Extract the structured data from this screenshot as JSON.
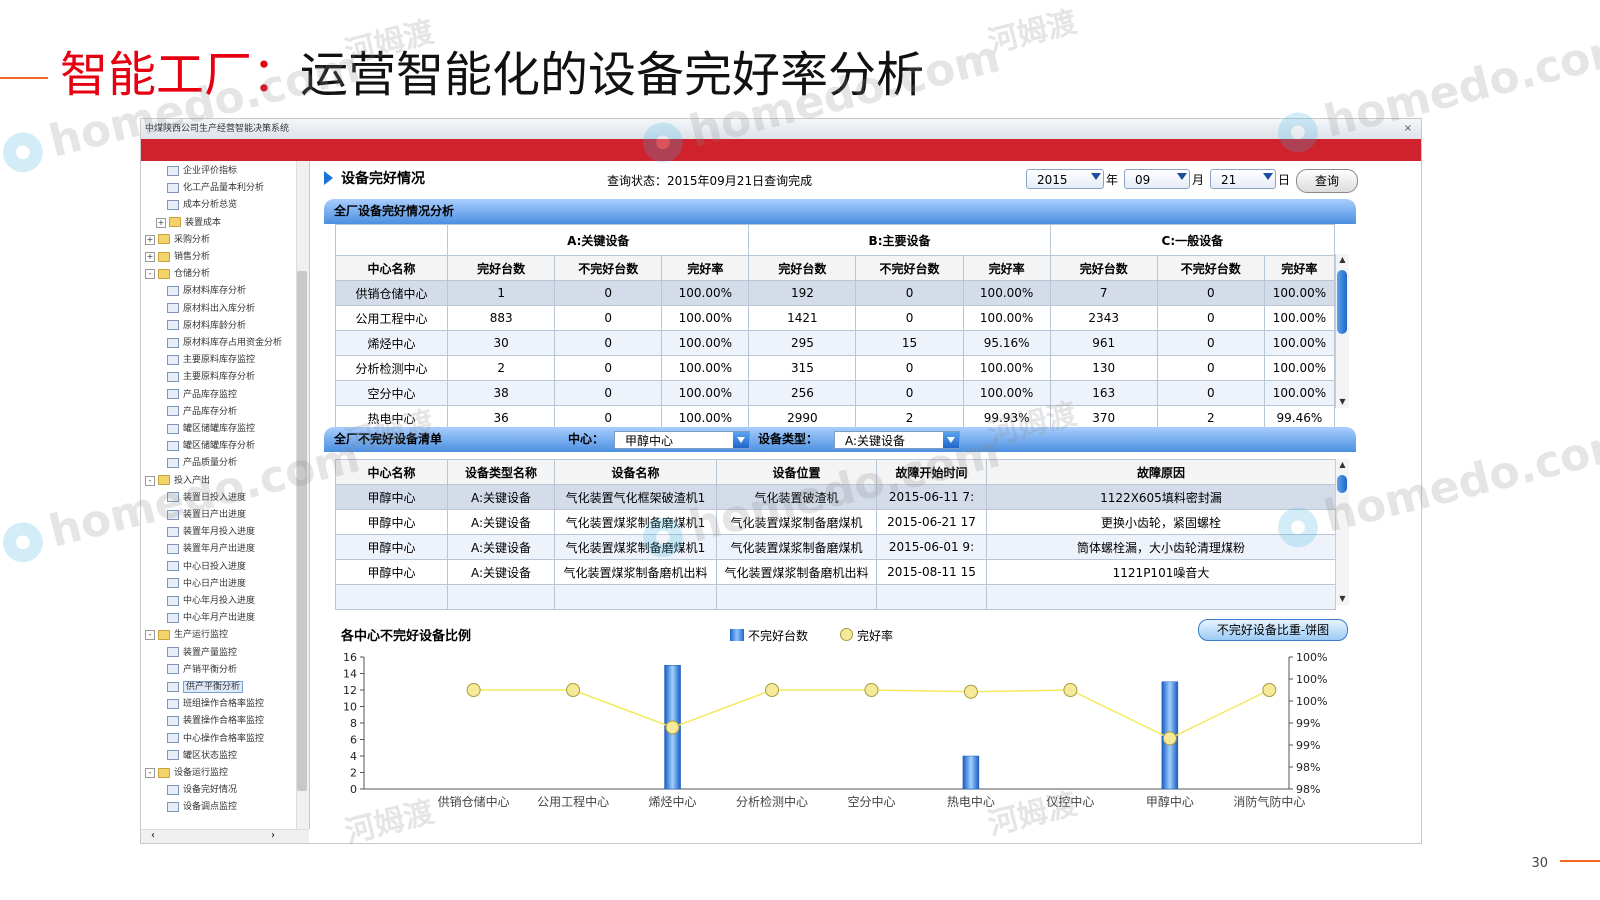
{
  "slide": {
    "title_prefix": "智能工厂：",
    "title_main": "运营智能化的设备完好率分析",
    "page_number": "30",
    "watermark_cn": "河姆渡",
    "watermark_en": "homedo.com"
  },
  "app": {
    "window_title": "中煤陕西公司生产经营智能决策系统",
    "close_label": "×"
  },
  "tree": {
    "items": [
      {
        "label": "企业评价指标",
        "type": "doc",
        "level": 2
      },
      {
        "label": "化工产品量本利分析",
        "type": "doc",
        "level": 2
      },
      {
        "label": "成本分析总览",
        "type": "doc",
        "level": 2
      },
      {
        "label": "装置成本",
        "type": "folder",
        "level": 1,
        "exp": "+"
      },
      {
        "label": "采购分析",
        "type": "folder",
        "level": 0,
        "exp": "+"
      },
      {
        "label": "销售分析",
        "type": "folder",
        "level": 0,
        "exp": "+"
      },
      {
        "label": "仓储分析",
        "type": "folder",
        "level": 0,
        "exp": "-"
      },
      {
        "label": "原材料库存分析",
        "type": "doc",
        "level": 2
      },
      {
        "label": "原材料出入库分析",
        "type": "doc",
        "level": 2
      },
      {
        "label": "原材料库龄分析",
        "type": "doc",
        "level": 2
      },
      {
        "label": "原材料库存占用资金分析",
        "type": "doc",
        "level": 2
      },
      {
        "label": "主要原料库存监控",
        "type": "doc",
        "level": 2
      },
      {
        "label": "主要原料库存分析",
        "type": "doc",
        "level": 2
      },
      {
        "label": "产品库存监控",
        "type": "doc",
        "level": 2
      },
      {
        "label": "产品库存分析",
        "type": "doc",
        "level": 2
      },
      {
        "label": "罐区储罐库存监控",
        "type": "doc",
        "level": 2
      },
      {
        "label": "罐区储罐库存分析",
        "type": "doc",
        "level": 2
      },
      {
        "label": "产品质量分析",
        "type": "doc",
        "level": 2
      },
      {
        "label": "投入产出",
        "type": "folder",
        "level": 0,
        "exp": "-"
      },
      {
        "label": "装置日投入进度",
        "type": "doc",
        "level": 2
      },
      {
        "label": "装置日产出进度",
        "type": "doc",
        "level": 2
      },
      {
        "label": "装置年月投入进度",
        "type": "doc",
        "level": 2
      },
      {
        "label": "装置年月产出进度",
        "type": "doc",
        "level": 2
      },
      {
        "label": "中心日投入进度",
        "type": "doc",
        "level": 2
      },
      {
        "label": "中心日产出进度",
        "type": "doc",
        "level": 2
      },
      {
        "label": "中心年月投入进度",
        "type": "doc",
        "level": 2
      },
      {
        "label": "中心年月产出进度",
        "type": "doc",
        "level": 2
      },
      {
        "label": "生产运行监控",
        "type": "folder",
        "level": 0,
        "exp": "-"
      },
      {
        "label": "装置产量监控",
        "type": "doc",
        "level": 2
      },
      {
        "label": "产销平衡分析",
        "type": "doc",
        "level": 2
      },
      {
        "label": "供产平衡分析",
        "type": "doc",
        "level": 2,
        "selected": true
      },
      {
        "label": "班组操作合格率监控",
        "type": "doc",
        "level": 2
      },
      {
        "label": "装置操作合格率监控",
        "type": "doc",
        "level": 2
      },
      {
        "label": "中心操作合格率监控",
        "type": "doc",
        "level": 2
      },
      {
        "label": "罐区状态监控",
        "type": "doc",
        "level": 2
      },
      {
        "label": "设备运行监控",
        "type": "folder",
        "level": 0,
        "exp": "-"
      },
      {
        "label": "设备完好情况",
        "type": "doc",
        "level": 2
      },
      {
        "label": "设备调点监控",
        "type": "doc",
        "level": 2
      }
    ]
  },
  "header": {
    "section_title": "设备完好情况",
    "query_status": "查询状态：2015年09月21日查询完成",
    "year": "2015",
    "year_unit": "年",
    "month": "09",
    "month_unit": "月",
    "day": "21",
    "day_unit": "日",
    "query_button": "查询"
  },
  "summary": {
    "bar_title": "全厂设备完好情况分析",
    "group_a": "A:关键设备",
    "group_b": "B:主要设备",
    "group_c": "C:一般设备",
    "columns": [
      "中心名称",
      "完好台数",
      "不完好台数",
      "完好率",
      "完好台数",
      "不完好台数",
      "完好率",
      "完好台数",
      "不完好台数",
      "完好率"
    ],
    "rows": [
      [
        "供销仓储中心",
        "1",
        "0",
        "100.00%",
        "192",
        "0",
        "100.00%",
        "7",
        "0",
        "100.00%"
      ],
      [
        "公用工程中心",
        "883",
        "0",
        "100.00%",
        "1421",
        "0",
        "100.00%",
        "2343",
        "0",
        "100.00%"
      ],
      [
        "烯烃中心",
        "30",
        "0",
        "100.00%",
        "295",
        "15",
        "95.16%",
        "961",
        "0",
        "100.00%"
      ],
      [
        "分析检测中心",
        "2",
        "0",
        "100.00%",
        "315",
        "0",
        "100.00%",
        "130",
        "0",
        "100.00%"
      ],
      [
        "空分中心",
        "38",
        "0",
        "100.00%",
        "256",
        "0",
        "100.00%",
        "163",
        "0",
        "100.00%"
      ],
      [
        "热电中心",
        "36",
        "0",
        "100.00%",
        "2990",
        "2",
        "99.93%",
        "370",
        "2",
        "99.46%"
      ]
    ]
  },
  "faults": {
    "bar_title": "全厂不完好设备清单",
    "center_label": "中心：",
    "center_value": "甲醇中心",
    "type_label": "设备类型：",
    "type_value": "A:关键设备",
    "columns": [
      "中心名称",
      "设备类型名称",
      "设备名称",
      "设备位置",
      "故障开始时间",
      "故障原因"
    ],
    "rows": [
      [
        "甲醇中心",
        "A:关键设备",
        "气化装置气化框架破渣机1",
        "气化装置破渣机",
        "2015-06-11 7:",
        "1122X605填料密封漏"
      ],
      [
        "甲醇中心",
        "A:关键设备",
        "气化装置煤浆制备磨煤机1",
        "气化装置煤浆制备磨煤机",
        "2015-06-21 17",
        "更换小齿轮，紧固螺栓"
      ],
      [
        "甲醇中心",
        "A:关键设备",
        "气化装置煤浆制备磨煤机1",
        "气化装置煤浆制备磨煤机",
        "2015-06-01 9:",
        "筒体螺栓漏，大小齿轮清理煤粉"
      ],
      [
        "甲醇中心",
        "A:关键设备",
        "气化装置煤浆制备磨机出料",
        "气化装置煤浆制备磨机出料",
        "2015-08-11 15",
        "1121P101噪音大"
      ]
    ]
  },
  "chart": {
    "title": "各中心不完好设备比例",
    "legend_bar": "不完好台数",
    "legend_line": "完好率",
    "pie_button": "不完好设备比重-饼图",
    "colors": {
      "bar": "#1f66c8",
      "line": "#f2ea5c",
      "marker": "#f5ea9a"
    }
  },
  "chart_data": {
    "type": "bar",
    "title": "各中心不完好设备比例",
    "categories": [
      "供销仓储中心",
      "公用工程中心",
      "烯烃中心",
      "分析检测中心",
      "空分中心",
      "热电中心",
      "仪控中心",
      "甲醇中心",
      "消防气防中心"
    ],
    "series": [
      {
        "name": "不完好台数",
        "type": "bar",
        "axis": "left",
        "values": [
          0,
          0,
          15,
          0,
          0,
          4,
          0,
          13,
          0
        ]
      },
      {
        "name": "完好率",
        "type": "line",
        "axis": "right",
        "values": [
          100.0,
          100.0,
          99.15,
          100.0,
          100.0,
          99.96,
          100.0,
          98.9,
          100.0
        ]
      }
    ],
    "ylim": [
      0,
      16
    ],
    "yticks": [
      "0",
      "2",
      "4",
      "6",
      "8",
      "10",
      "12",
      "14",
      "16"
    ],
    "y2lim": [
      97.75,
      100.75
    ],
    "y2ticks": [
      "98%",
      "98%",
      "99%",
      "99%",
      "100%",
      "100%",
      "100%"
    ],
    "grid": false,
    "legend_position": "top-center"
  }
}
